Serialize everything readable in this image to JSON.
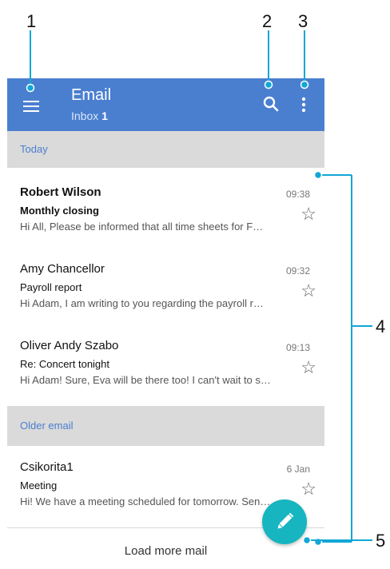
{
  "callouts": [
    "1",
    "2",
    "3",
    "4",
    "5"
  ],
  "appbar": {
    "title": "Email",
    "subtitle_prefix": "Inbox",
    "unread_count": "1",
    "icons": [
      "menu-icon",
      "search-icon",
      "more-vert-icon"
    ]
  },
  "sections": {
    "today": "Today",
    "older": "Older email"
  },
  "emails": [
    {
      "sender": "Robert Wilson",
      "time": "09:38",
      "subject": "Monthly closing",
      "preview": "Hi All, Please be informed that all time sheets for F…",
      "unread": true
    },
    {
      "sender": "Amy Chancellor",
      "time": "09:32",
      "subject": "Payroll report",
      "preview": "Hi Adam, I am writing to you regarding the payroll r…",
      "unread": false
    },
    {
      "sender": "Oliver Andy Szabo",
      "time": "09:13",
      "subject": "Re: Concert tonight",
      "preview": "Hi Adam! Sure, Eva will be there too! I can't wait to s…",
      "unread": false
    },
    {
      "sender": "Csikorita1",
      "time": "6 Jan",
      "subject": "Meeting",
      "preview": "Hi! We have a meeting scheduled for tomorrow. Sen…",
      "unread": false
    }
  ],
  "load_more": "Load more mail",
  "fab_icon": "pencil-icon",
  "colors": {
    "appbar": "#4a7fd0",
    "section_bg": "#dadada",
    "section_text": "#4a7fd0",
    "fab": "#16b5c0"
  }
}
